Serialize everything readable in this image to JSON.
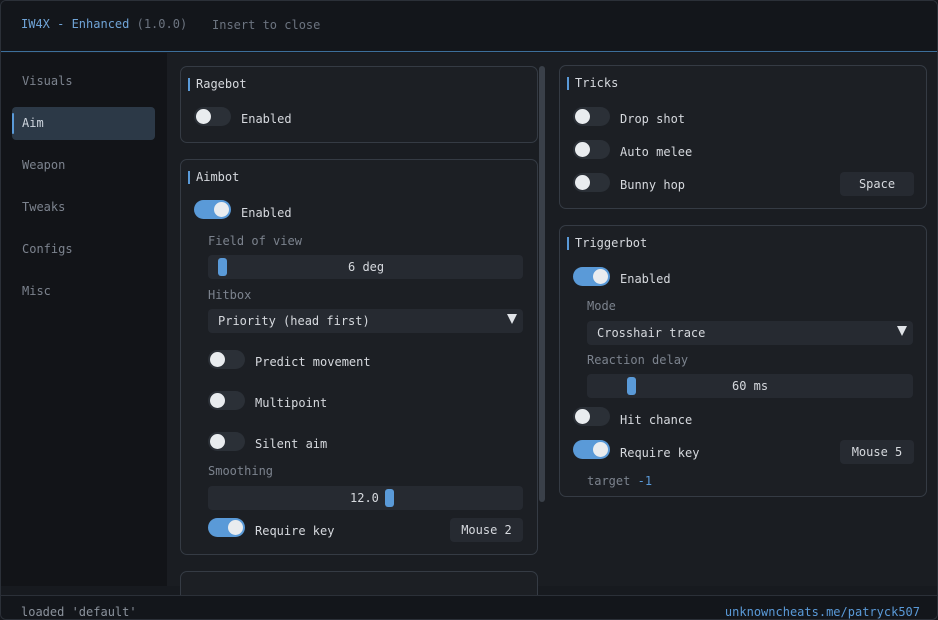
{
  "title": {
    "app": "IW4X - Enhanced",
    "version": "(1.0.0)",
    "hint": "Insert to close"
  },
  "sidebar": {
    "items": [
      {
        "label": "Visuals",
        "active": false
      },
      {
        "label": "Aim",
        "active": true
      },
      {
        "label": "Weapon",
        "active": false
      },
      {
        "label": "Tweaks",
        "active": false
      },
      {
        "label": "Configs",
        "active": false
      },
      {
        "label": "Misc",
        "active": false
      }
    ]
  },
  "ragebot": {
    "title": "Ragebot",
    "enabled_label": "Enabled",
    "enabled": false
  },
  "aimbot": {
    "title": "Aimbot",
    "enabled_label": "Enabled",
    "enabled": true,
    "fov_label": "Field of view",
    "fov_value": "6 deg",
    "fov_fraction": 0.0,
    "hitbox_label": "Hitbox",
    "hitbox_value": "Priority (head first)",
    "predict_label": "Predict movement",
    "predict": false,
    "multipoint_label": "Multipoint",
    "multipoint": false,
    "silent_label": "Silent aim",
    "silent": false,
    "smoothing_label": "Smoothing",
    "smoothing_value": "12.0",
    "require_key_label": "Require key",
    "require_key": true,
    "key": "Mouse 2"
  },
  "tricks": {
    "title": "Tricks",
    "drop_shot_label": "Drop shot",
    "drop_shot": false,
    "auto_melee_label": "Auto melee",
    "auto_melee": false,
    "bunny_hop_label": "Bunny hop",
    "bunny_hop": false,
    "bunny_hop_key": "Space"
  },
  "triggerbot": {
    "title": "Triggerbot",
    "enabled_label": "Enabled",
    "enabled": true,
    "mode_label": "Mode",
    "mode_value": "Crosshair trace",
    "delay_label": "Reaction delay",
    "delay_value": "60 ms",
    "hit_chance_label": "Hit chance",
    "hit_chance": false,
    "require_key_label": "Require key",
    "require_key": true,
    "key": "Mouse 5",
    "target_label": "target",
    "target_value": "-1"
  },
  "status": {
    "left": "loaded 'default'",
    "right": "unknowncheats.me/patryck507"
  },
  "colors": {
    "accent": "#5a9ad8",
    "background": "#1a1d22",
    "panel": "#1c1f24"
  }
}
